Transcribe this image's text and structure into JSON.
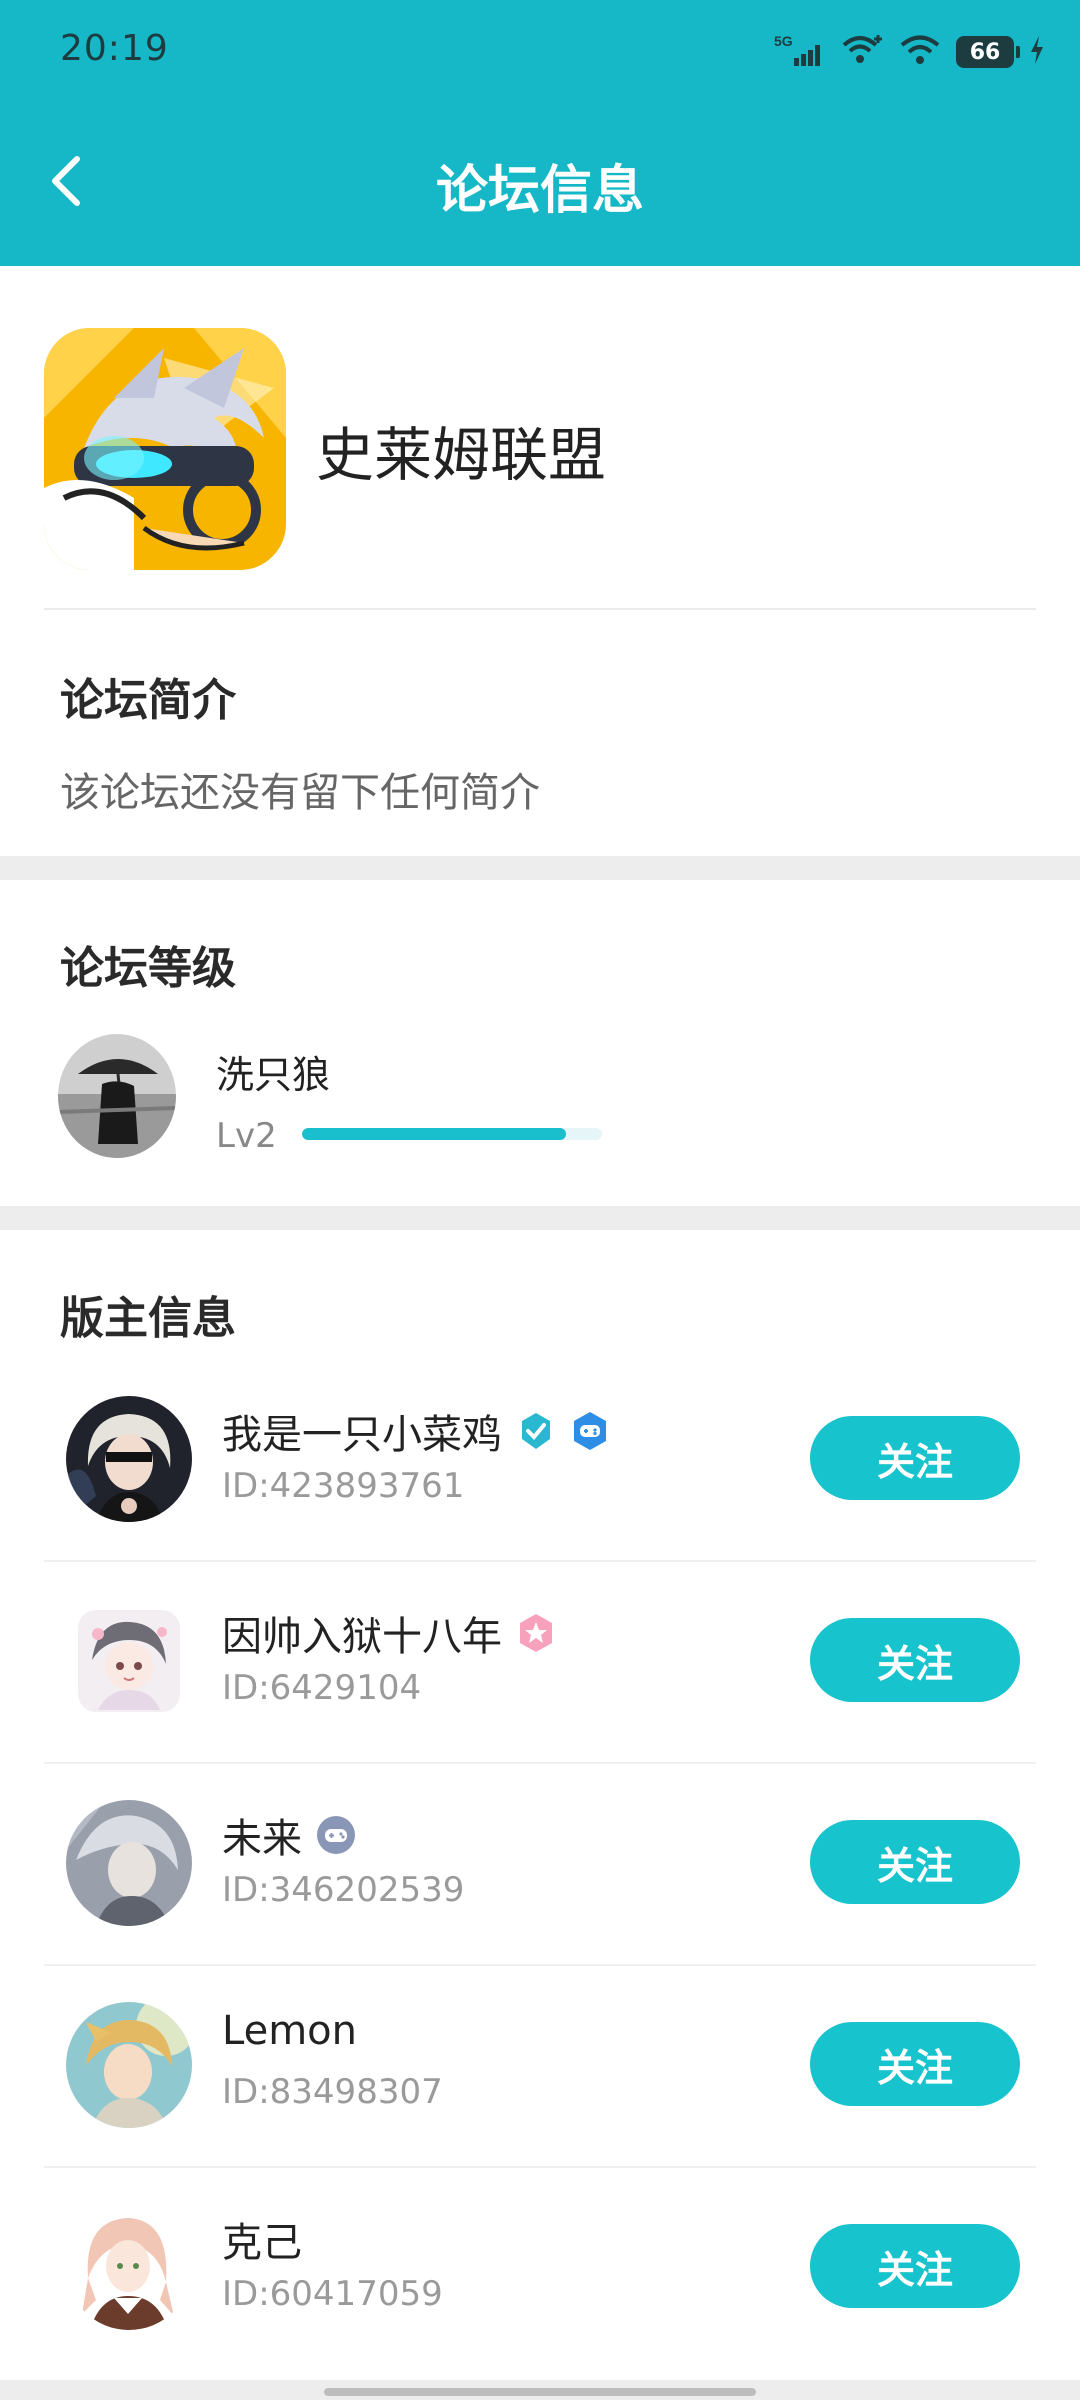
{
  "status_bar": {
    "time": "20:19",
    "network": "5G",
    "battery": "66"
  },
  "header": {
    "title": "论坛信息"
  },
  "forum": {
    "name": "史莱姆联盟"
  },
  "intro": {
    "title": "论坛简介",
    "text": "该论坛还没有留下任何简介"
  },
  "level": {
    "title": "论坛等级",
    "user_name": "洗只狼",
    "level_label": "Lv2",
    "progress": 0.88
  },
  "moderators": {
    "title": "版主信息",
    "follow_label": "关注",
    "items": [
      {
        "name": "我是一只小菜鸡",
        "id": "ID:423893761",
        "badges": [
          "verified-icon",
          "gamepad-badge-icon"
        ]
      },
      {
        "name": "因帅入狱十八年",
        "id": "ID:6429104",
        "badges": [
          "pink-star-badge-icon"
        ]
      },
      {
        "name": "未来",
        "id": "ID:346202539",
        "badges": [
          "controller-badge-icon"
        ]
      },
      {
        "name": "Lemon",
        "id": "ID:83498307",
        "badges": []
      },
      {
        "name": "克己",
        "id": "ID:60417059",
        "badges": []
      }
    ]
  },
  "colors": {
    "accent": "#16b7c6",
    "button": "#17c3cc"
  }
}
